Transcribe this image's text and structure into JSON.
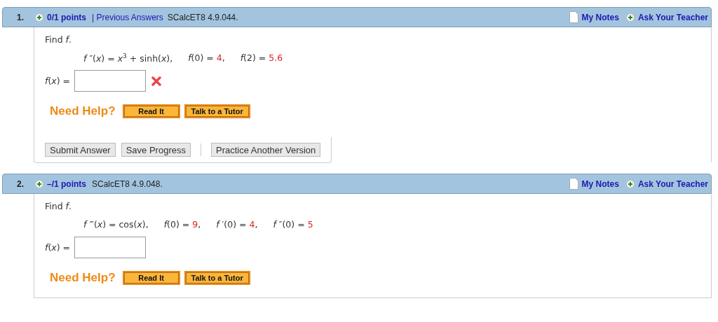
{
  "questions": [
    {
      "number": "1.",
      "points": "0/1 points",
      "previous_answers": "| Previous Answers",
      "source": "SCalcET8 4.9.044.",
      "my_notes": "My Notes",
      "ask_teacher": "Ask Your Teacher",
      "prompt": "Find *f*.",
      "terms": [
        {
          "lhs": "*f* ″(*x*) = *x*$^{3}$ + sinh(*x*),"
        },
        {
          "lhs": "*f*(0) = ",
          "value": "4",
          "tail": ","
        },
        {
          "lhs": "*f*(2) = ",
          "value": "5.6"
        }
      ],
      "answer_label": "*f*(*x*) =",
      "incorrect": true,
      "help_label": "Need Help?",
      "help_buttons": [
        "Read It",
        "Talk to a Tutor"
      ],
      "actions": [
        "Submit Answer",
        "Save Progress"
      ],
      "practice": "Practice Another Version"
    },
    {
      "number": "2.",
      "points": "–/1 points",
      "source": "SCalcET8 4.9.048.",
      "my_notes": "My Notes",
      "ask_teacher": "Ask Your Teacher",
      "prompt": "Find *f*.",
      "terms": [
        {
          "lhs": "*f* ‴(*x*) = cos(*x*),"
        },
        {
          "lhs": "*f*(0) = ",
          "value": "9",
          "tail": ","
        },
        {
          "lhs": "*f* ′(0) = ",
          "value": "4",
          "tail": ","
        },
        {
          "lhs": "*f* ″(0) = ",
          "value": "5"
        }
      ],
      "answer_label": "*f*(*x*) =",
      "help_label": "Need Help?",
      "help_buttons": [
        "Read It",
        "Talk to a Tutor"
      ]
    }
  ]
}
